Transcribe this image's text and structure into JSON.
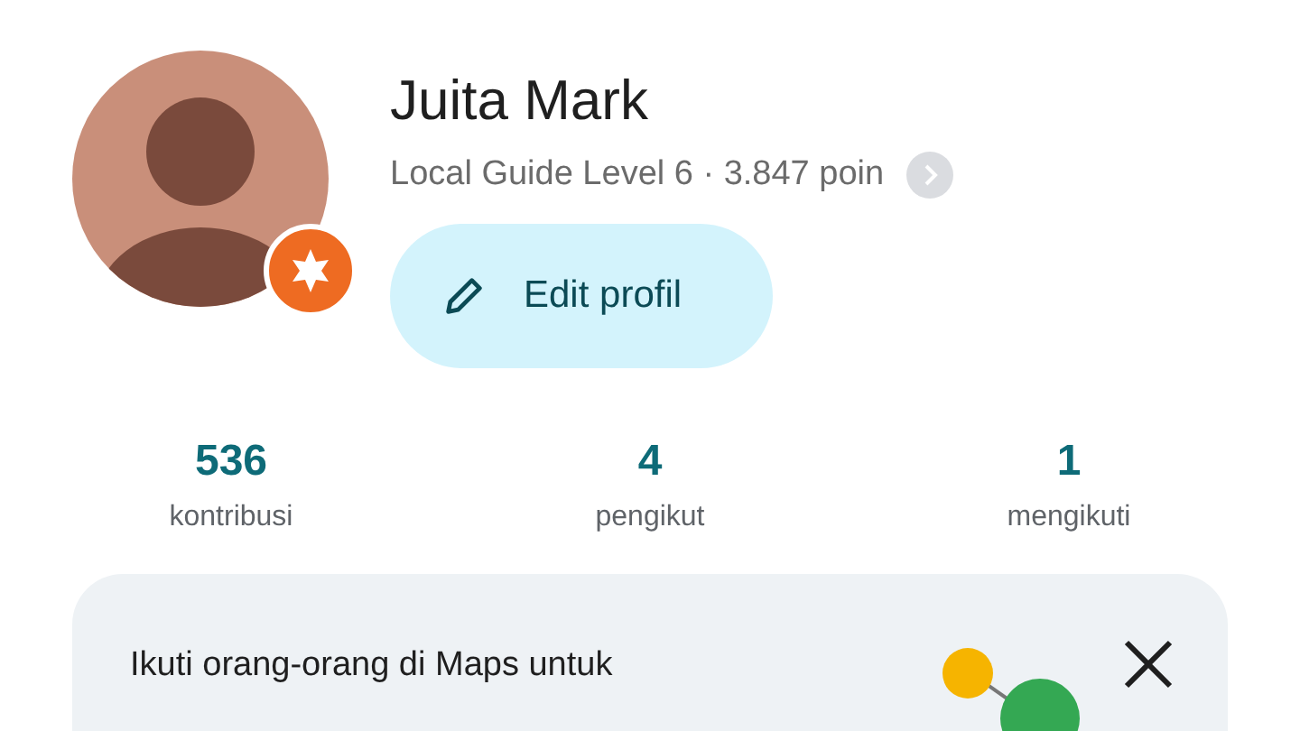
{
  "profile": {
    "name": "Juita Mark",
    "subtitle": "Local Guide Level 6 · 3.847 poin",
    "edit_button": "Edit profil"
  },
  "stats": [
    {
      "value": "536",
      "label": "kontribusi"
    },
    {
      "value": "4",
      "label": "pengikut"
    },
    {
      "value": "1",
      "label": "mengikuti"
    }
  ],
  "suggestion_card": {
    "text": "Ikuti orang-orang di Maps untuk"
  }
}
